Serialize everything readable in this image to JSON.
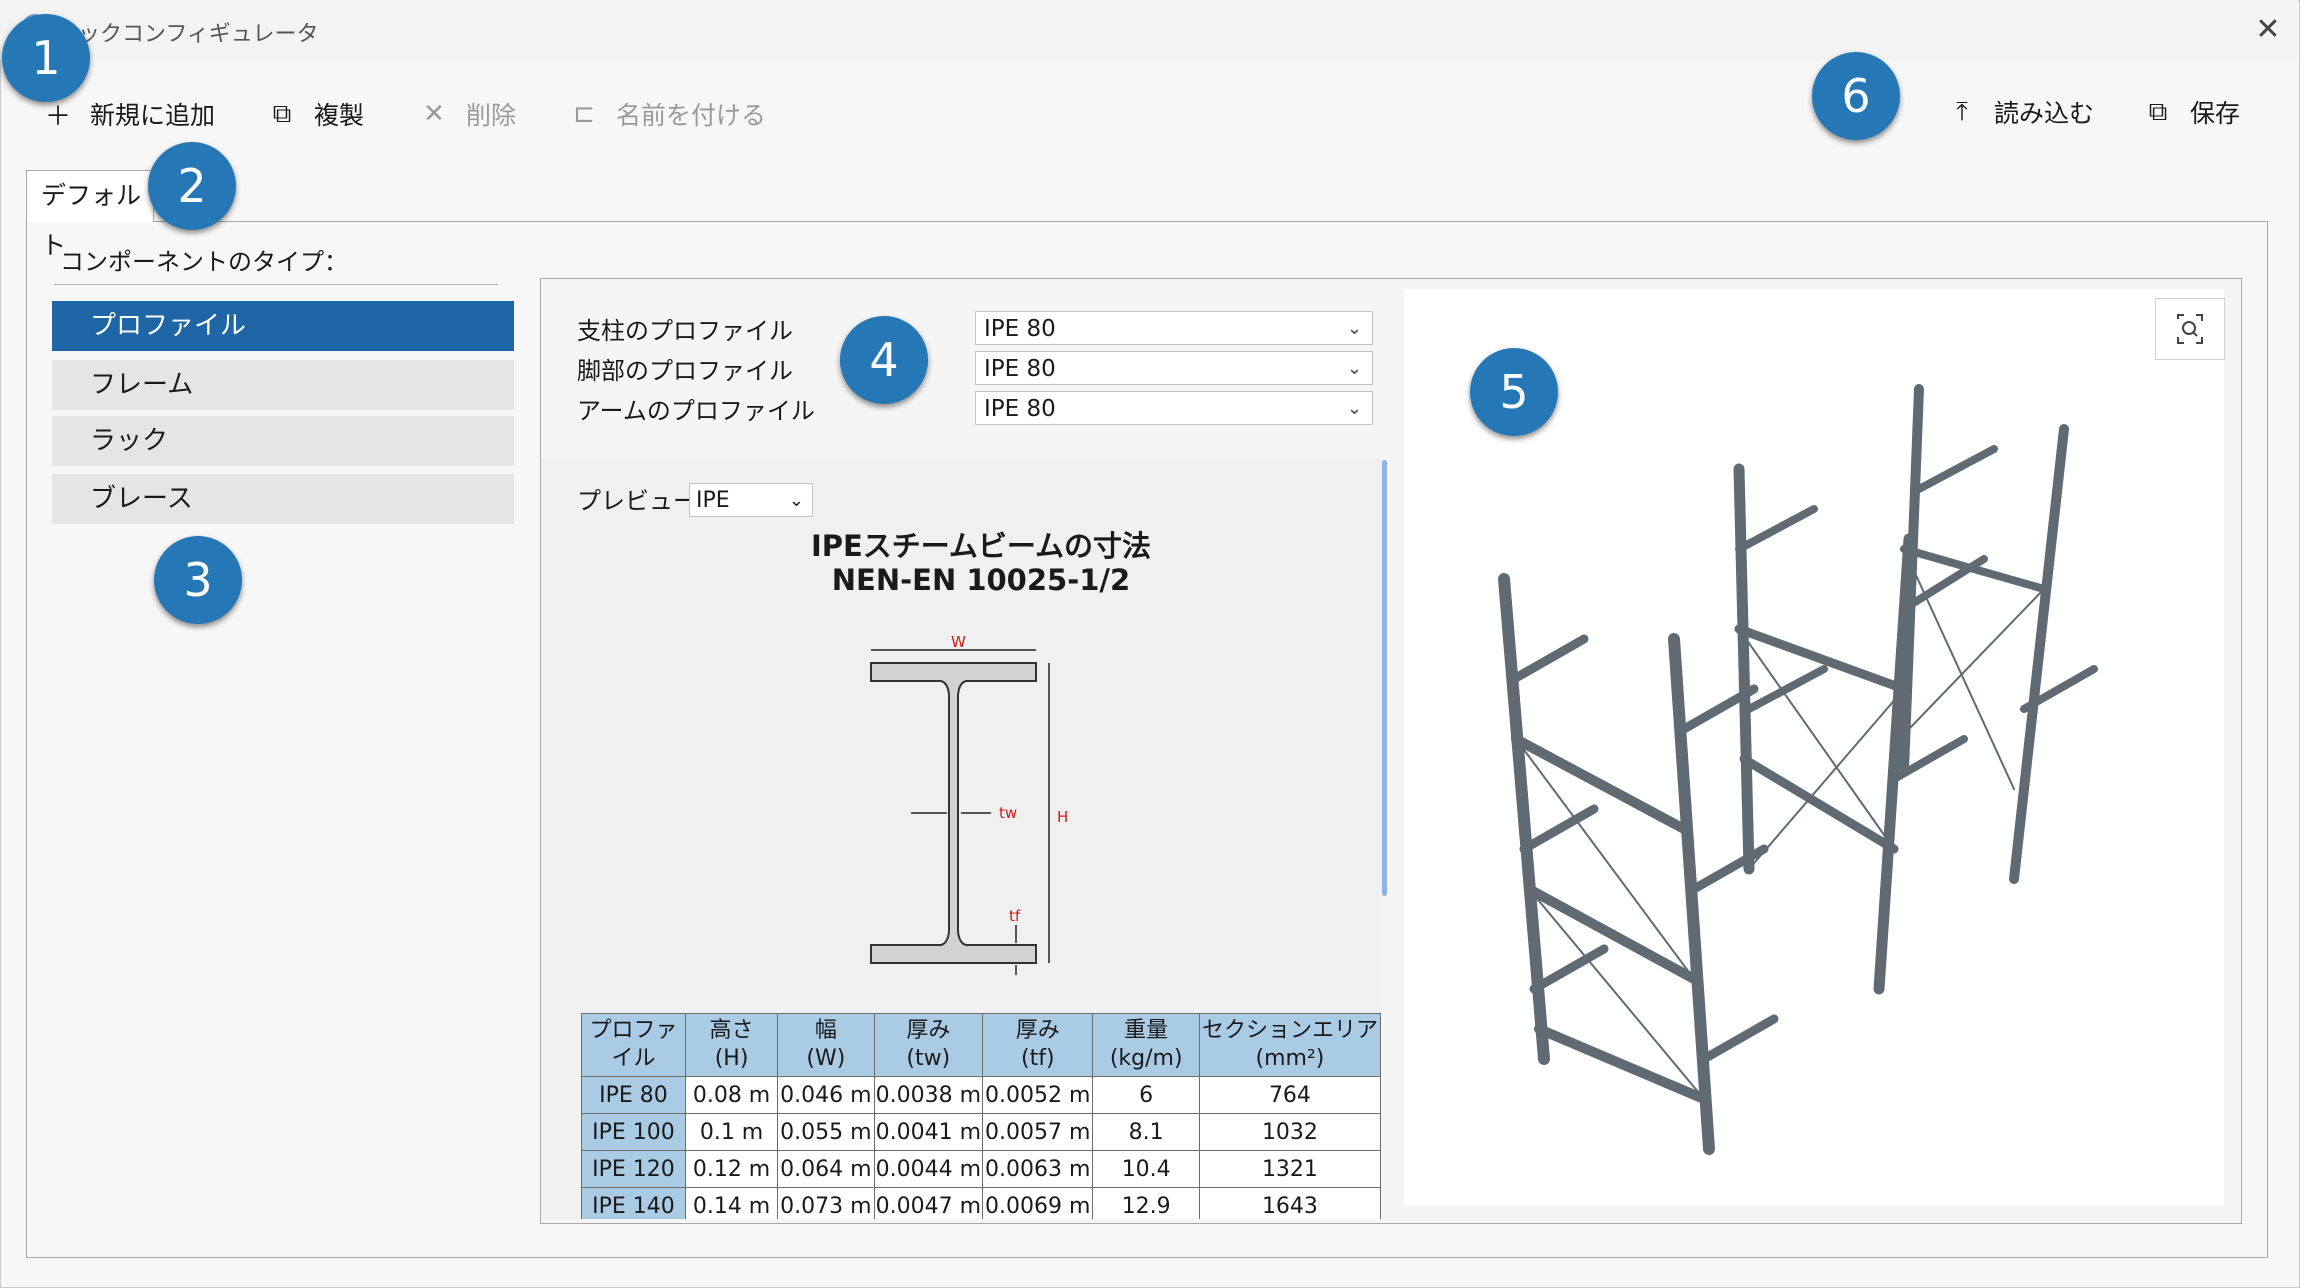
{
  "window": {
    "title": "ラックコンフィギュレータ"
  },
  "toolbar": {
    "add": "新規に追加",
    "duplicate": "複製",
    "delete": "削除",
    "rename": "名前を付ける",
    "load": "読み込む",
    "save": "保存"
  },
  "tabs": [
    {
      "label": "デフォルト"
    }
  ],
  "component_types": {
    "label": "コンポーネントのタイプ：",
    "items": [
      {
        "label": "プロファイル",
        "selected": true
      },
      {
        "label": "フレーム"
      },
      {
        "label": "ラック"
      },
      {
        "label": "ブレース"
      }
    ]
  },
  "profiles": {
    "post_label": "支柱のプロファイル",
    "post_value": "IPE 80",
    "leg_label": "脚部のプロファイル",
    "leg_value": "IPE 80",
    "arm_label": "アームのプロファイル",
    "arm_value": "IPE 80"
  },
  "preview": {
    "label": "プレビュー:",
    "value": "IPE",
    "title1": "IPEスチームビームの寸法",
    "title2": "NEN-EN 10025-1/2",
    "diagram": {
      "w": "W",
      "tw": "tw",
      "h": "H",
      "tf": "tf"
    }
  },
  "table": {
    "headers": [
      {
        "l1": "プロファイル",
        "l2": ""
      },
      {
        "l1": "高さ",
        "l2": "(H)"
      },
      {
        "l1": "幅",
        "l2": "(W)"
      },
      {
        "l1": "厚み",
        "l2": "(tw)"
      },
      {
        "l1": "厚み",
        "l2": "(tf)"
      },
      {
        "l1": "重量",
        "l2": "(kg/m)"
      },
      {
        "l1": "セクションエリア",
        "l2": "(mm²)"
      }
    ],
    "rows": [
      [
        "IPE 80",
        "0.08 m",
        "0.046 m",
        "0.0038 m",
        "0.0052 m",
        "6",
        "764"
      ],
      [
        "IPE 100",
        "0.1 m",
        "0.055 m",
        "0.0041 m",
        "0.0057 m",
        "8.1",
        "1032"
      ],
      [
        "IPE 120",
        "0.12 m",
        "0.064 m",
        "0.0044 m",
        "0.0063 m",
        "10.4",
        "1321"
      ],
      [
        "IPE 140",
        "0.14 m",
        "0.073 m",
        "0.0047 m",
        "0.0069 m",
        "12.9",
        "1643"
      ]
    ]
  },
  "badges": [
    "1",
    "2",
    "3",
    "4",
    "5",
    "6"
  ],
  "colors": {
    "accent": "#1e66a6",
    "badge": "#2577b5",
    "table_header": "#a9cbe4",
    "rack": "#5f6a72"
  }
}
